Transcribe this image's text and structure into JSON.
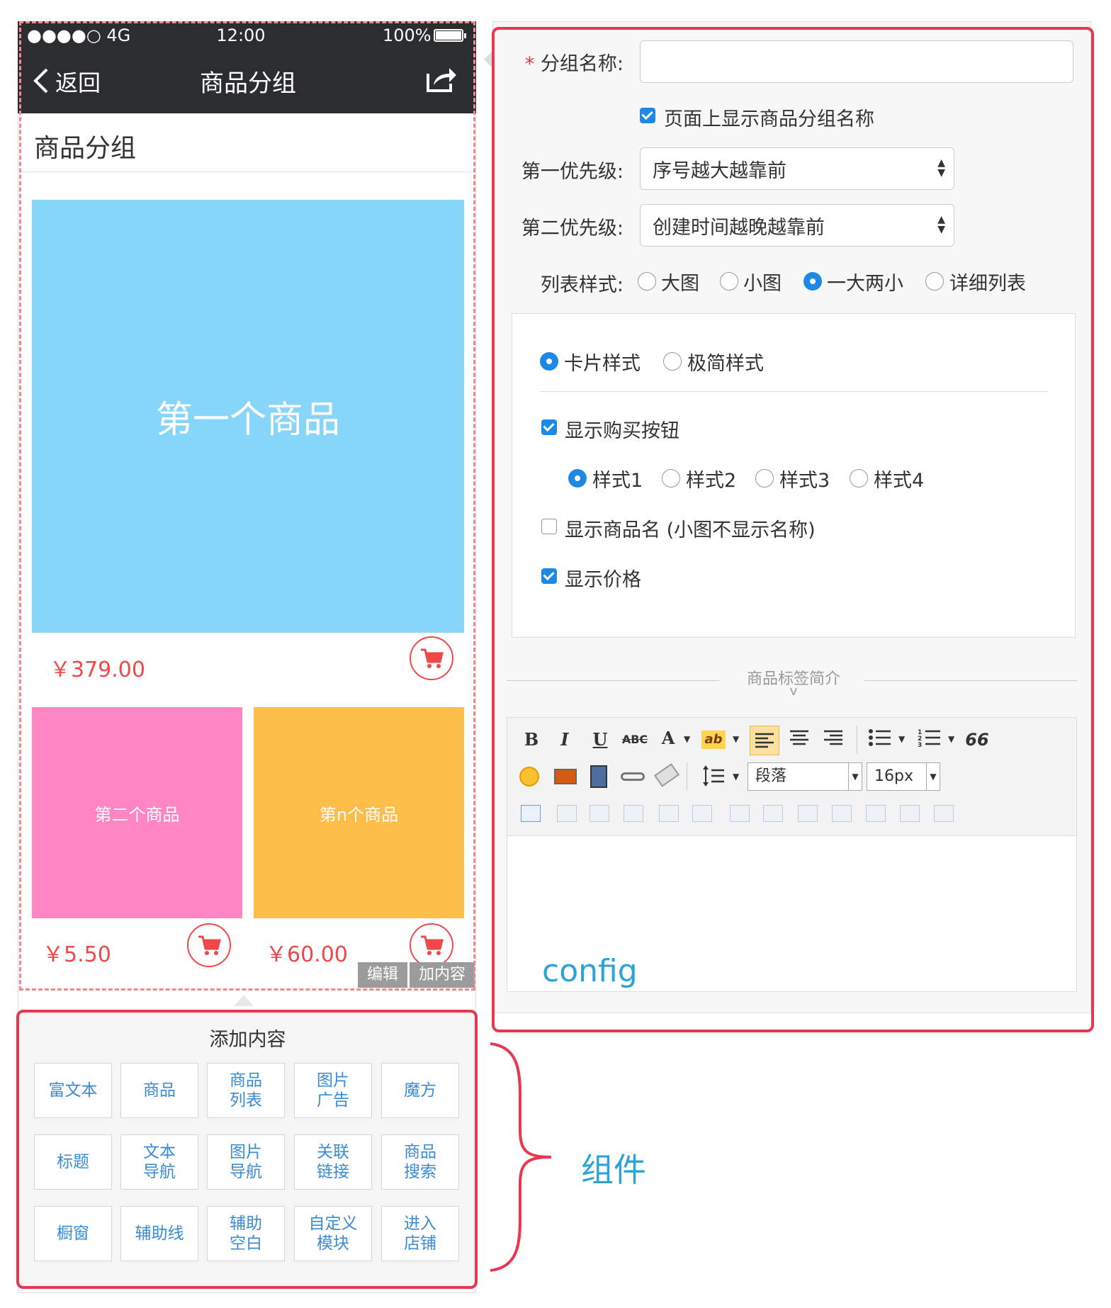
{
  "status_bar": {
    "carrier": "●●●●○ 4G",
    "time": "12:00",
    "battery": "100%"
  },
  "nav": {
    "back_label": "返回",
    "title": "商品分组"
  },
  "page_heading": "商品分组",
  "products": [
    {
      "name": "第一个商品",
      "price": "￥379.00"
    },
    {
      "name": "第二个商品",
      "price": "￥5.50"
    },
    {
      "name": "第n个商品",
      "price": "￥60.00"
    }
  ],
  "overlay_actions": {
    "edit": "编辑",
    "add": "加内容"
  },
  "add_content": {
    "title": "添加内容",
    "components": [
      [
        "富文本"
      ],
      [
        "商品"
      ],
      [
        "商品",
        "列表"
      ],
      [
        "图片",
        "广告"
      ],
      [
        "魔方"
      ],
      [
        "标题"
      ],
      [
        "文本",
        "导航"
      ],
      [
        "图片",
        "导航"
      ],
      [
        "关联",
        "链接"
      ],
      [
        "商品",
        "搜索"
      ],
      [
        "橱窗"
      ],
      [
        "辅助线"
      ],
      [
        "辅助",
        "空白"
      ],
      [
        "自定义",
        "模块"
      ],
      [
        "进入",
        "店铺"
      ]
    ]
  },
  "config": {
    "group_name_label": "分组名称:",
    "group_name_required": "*",
    "group_name_value": "",
    "show_group_name": {
      "label": "页面上显示商品分组名称",
      "checked": true
    },
    "priority1": {
      "label": "第一优先级:",
      "value": "序号越大越靠前"
    },
    "priority2": {
      "label": "第二优先级:",
      "value": "创建时间越晚越靠前"
    },
    "list_style": {
      "label": "列表样式:",
      "options": [
        "大图",
        "小图",
        "一大两小",
        "详细列表"
      ],
      "selected": "一大两小"
    },
    "card_style": {
      "options": [
        "卡片样式",
        "极简样式"
      ],
      "selected": "卡片样式"
    },
    "show_buy_button": {
      "label": "显示购买按钮",
      "checked": true
    },
    "buy_button_style": {
      "options": [
        "样式1",
        "样式2",
        "样式3",
        "样式4"
      ],
      "selected": "样式1"
    },
    "show_product_name": {
      "label": "显示商品名 (小图不显示名称)",
      "checked": false
    },
    "show_price": {
      "label": "显示价格",
      "checked": true
    },
    "tag_intro": {
      "title": "商品标签简介",
      "toggle": "v"
    },
    "editor": {
      "paragraph": "段落",
      "font_size": "16px",
      "buttons_row1": [
        "B",
        "I",
        "U",
        "ABC",
        "A",
        "ab",
        "align-left",
        "align-center",
        "align-right",
        "unordered-list",
        "ordered-list",
        "quote"
      ],
      "quote_glyph": "66"
    }
  },
  "annotations": {
    "config": "config",
    "components": "组件"
  },
  "colors": {
    "accent_red": "#e8374f",
    "blue": "#1e88e5",
    "annotation": "#2ca3d7",
    "price": "#f04848"
  }
}
